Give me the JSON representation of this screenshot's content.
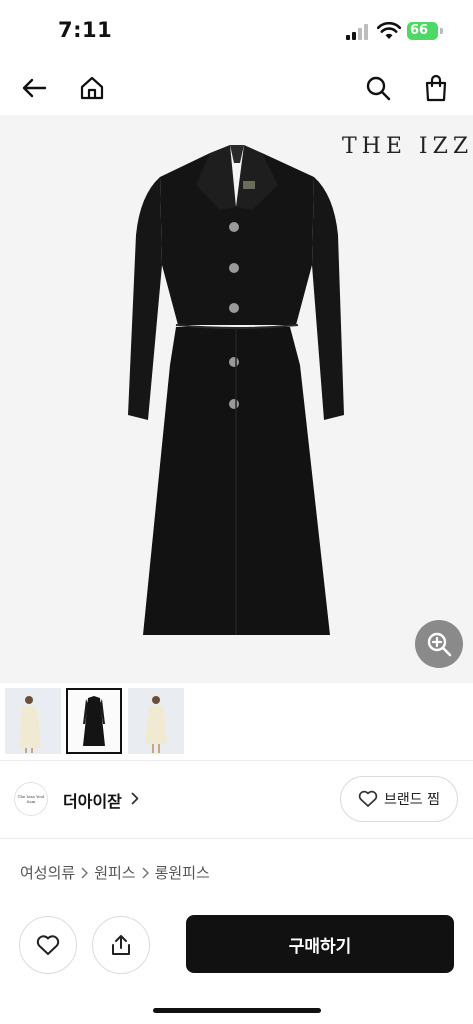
{
  "status_bar": {
    "time": "7:11",
    "battery_level": "66",
    "icons": [
      "signal-icon",
      "wifi-icon",
      "battery-icon"
    ]
  },
  "nav": {
    "icons": [
      "back-arrow-icon",
      "home-icon",
      "search-icon",
      "shopping-bag-icon"
    ]
  },
  "product": {
    "image_brand_text": "THE IZZA",
    "thumbnails": [
      {
        "name": "thumb-ivory-front"
      },
      {
        "name": "thumb-black-dress",
        "selected": true
      },
      {
        "name": "thumb-ivory-side"
      }
    ]
  },
  "brand": {
    "logo_text": "The Izza Yeol Sam",
    "name": "더아이잗",
    "like_label": "브랜드 찜"
  },
  "breadcrumb": [
    "여성의류",
    "원피스",
    "롱원피스"
  ],
  "actions": {
    "buy_label": "구매하기"
  },
  "colors": {
    "accent": "#111111",
    "image_bg": "#f4f4f4",
    "battery": "#4cd964"
  }
}
